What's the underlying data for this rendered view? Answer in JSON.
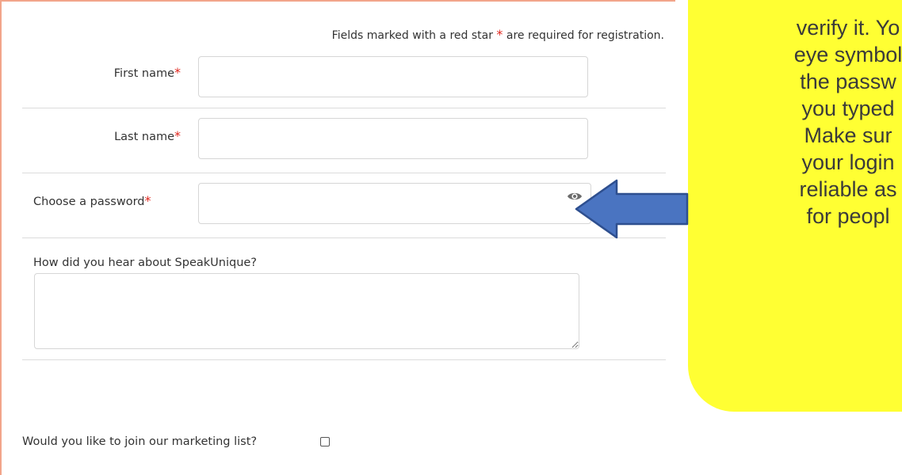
{
  "form": {
    "required_note_prefix": "Fields marked with a red star",
    "required_note_suffix": "are required for registration.",
    "required_star": "*",
    "fields": {
      "first_name_label": "First name",
      "last_name_label": "Last name",
      "password_label": "Choose a password",
      "hear_label": "How did you hear about SpeakUnique?"
    },
    "first_name_value": "",
    "last_name_value": "",
    "password_value": "",
    "hear_value": "",
    "marketing_label": "Would you like to join our marketing list?",
    "marketing_checked": false
  },
  "callout": {
    "text": "verify it. Yo\neye symbol\nthe passw\nyou typed\nMake sur\nyour login\nreliable as\nfor peopl",
    "color": "#ffff33"
  },
  "colors": {
    "required_star": "#e0281f",
    "panel_border": "#f2a58a",
    "arrow_fill": "#4a74c1",
    "arrow_stroke": "#2e4f8f"
  },
  "icons": {
    "password_toggle": "eye-icon",
    "pointer": "left-arrow-icon"
  }
}
